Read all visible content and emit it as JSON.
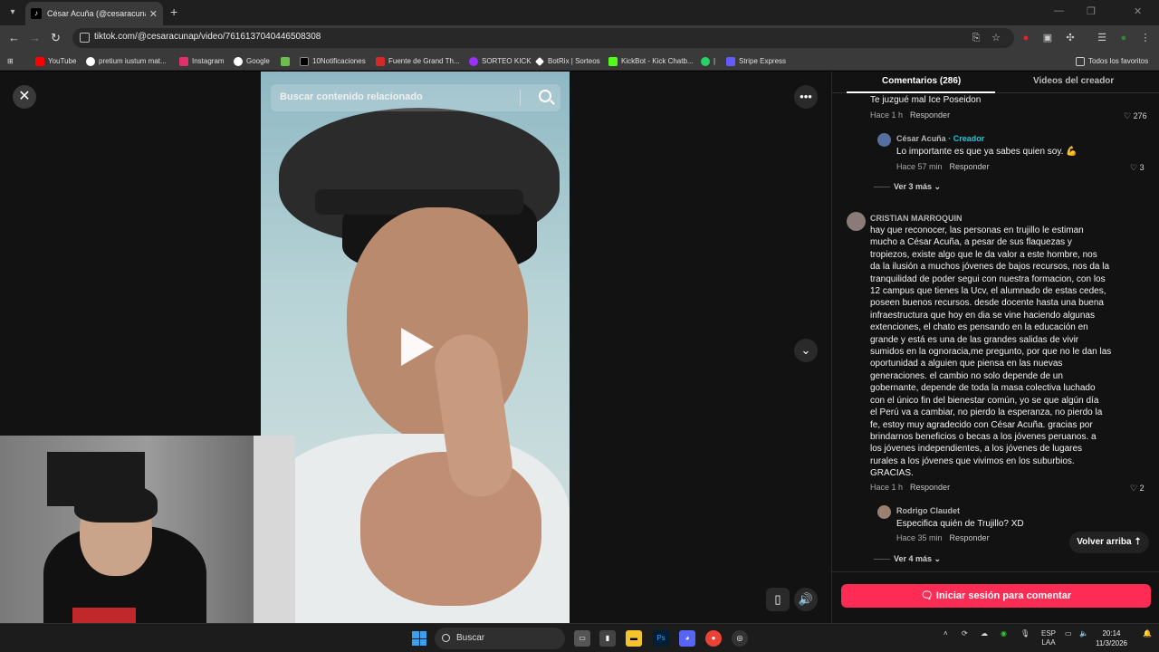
{
  "browser": {
    "tab_title": "César Acuña (@cesaracunap) | T",
    "url": "tiktok.com/@cesaracunap/video/7616137040446508308",
    "bookmarks": [
      {
        "label": "YouTube",
        "color": "#ff0000"
      },
      {
        "label": "pretium iustum mat...",
        "color": "#ffffff"
      },
      {
        "label": "Instagram",
        "color": "#e1306c"
      },
      {
        "label": "Google",
        "color": "#ffffff"
      },
      {
        "label": "",
        "color": "#6cbf4a"
      },
      {
        "label": "10Notificaciones",
        "color": "#000000"
      },
      {
        "label": "Fuente de Grand Th...",
        "color": "#d62828"
      },
      {
        "label": "SORTEO KICK",
        "color": "#9b30ff"
      },
      {
        "label": "BotRix | Sorteos",
        "color": "#ffffff"
      },
      {
        "label": "KickBot - Kick Chatb...",
        "color": "#53fc18"
      },
      {
        "label": "|",
        "color": "#25d366"
      },
      {
        "label": "Stripe Express",
        "color": "#635bff"
      }
    ],
    "all_favorites": "Todos los favoritos"
  },
  "video": {
    "search_placeholder": "Buscar contenido relacionado"
  },
  "comments_panel": {
    "tab_comments": "Comentarios (286)",
    "tab_creator_videos": "Videos del creador",
    "thread1": {
      "text": "Te juzgué mal Ice Poseidon",
      "time": "Hace 1 h",
      "reply": "Responder",
      "likes": "276",
      "reply_user": "César Acuña",
      "creator_tag": "· Creador",
      "reply_text": "Lo importante es que ya sabes quien soy. 💪",
      "reply_time": "Hace 57 min",
      "reply_reply": "Responder",
      "reply_likes": "3",
      "more": "Ver 3 más"
    },
    "thread2": {
      "user": "CRISTIAN MARROQUIN",
      "lines": [
        "hay que reconocer, las personas en trujillo le estiman",
        "mucho a César Acuña, a pesar de sus flaquezas y",
        "tropiezos, existe algo que le da valor a este hombre, nos",
        "da la ilusión a muchos jóvenes de bajos recursos, nos da la",
        "tranquilidad de poder segui con nuestra formacion, con los",
        "12 campus que tienes la Ucv, el alumnado de estas cedes,",
        "poseen buenos recursos. desde docente hasta una buena",
        "infraestructura que hoy en dia se vine haciendo algunas",
        "extenciones, el chato es pensando en la educación en",
        "grande y está es una de las grandes salidas de vivir",
        "sumidos en la ognoracia,me pregunto, por que no le dan las",
        "oportunidad a alguien que piensa en las nuevas",
        "generaciones. el cambio no solo depende de un",
        "gobernante, depende de toda la masa colectiva luchado",
        "con el único fin del bienestar común, yo se que algún día",
        "el Perú va a cambiar, no pierdo la esperanza, no pierdo la",
        "fe, estoy muy agradecido con César Acuña. gracias por",
        "brindarnos beneficios o becas a los jóvenes peruanos. a",
        "los jóvenes independientes, a los jóvenes de lugares",
        "rurales a los jóvenes que vivimos en los suburbios.",
        "GRACIAS."
      ],
      "time": "Hace 1 h",
      "reply": "Responder",
      "likes": "2",
      "reply_user": "Rodrigo Claudet",
      "reply_text": "Especifica quién de Trujillo? XD",
      "reply_time": "Hace 35 min",
      "reply_reply": "Responder",
      "more": "Ver 4 más"
    },
    "back_to_top": "Volver arriba",
    "login_button": "Iniciar sesión para comentar"
  },
  "taskbar": {
    "search_label": "Buscar",
    "lang": "ESP",
    "lang2": "LAA",
    "time": "20:14",
    "date": "11/3/2026"
  }
}
